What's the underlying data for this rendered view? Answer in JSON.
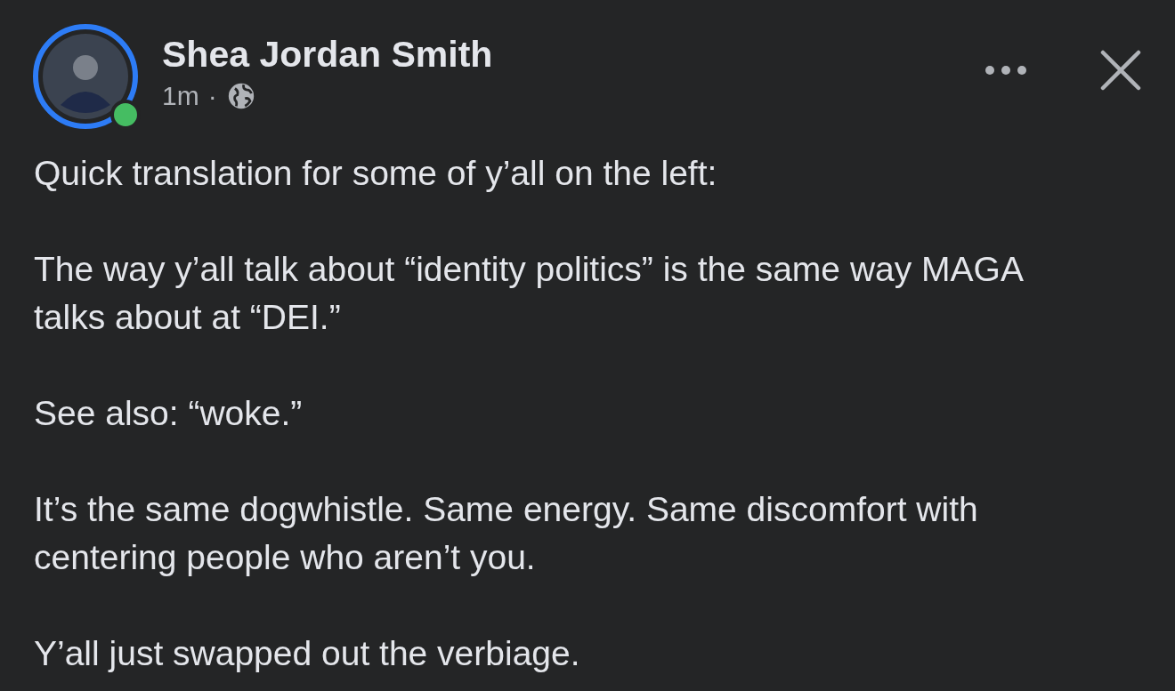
{
  "post": {
    "author": "Shea Jordan Smith",
    "online": true,
    "time": "1m",
    "separator": "·",
    "paragraphs": [
      "Quick translation for some of y’all on the left:",
      "The way y’all talk about “identity politics” is the same way MAGA talks about at “DEI.”",
      "See also: “woke.”",
      "It’s the same dogwhistle. Same energy. Same discomfort with centering people who aren’t you.",
      "Y’all just swapped out the verbiage."
    ]
  }
}
